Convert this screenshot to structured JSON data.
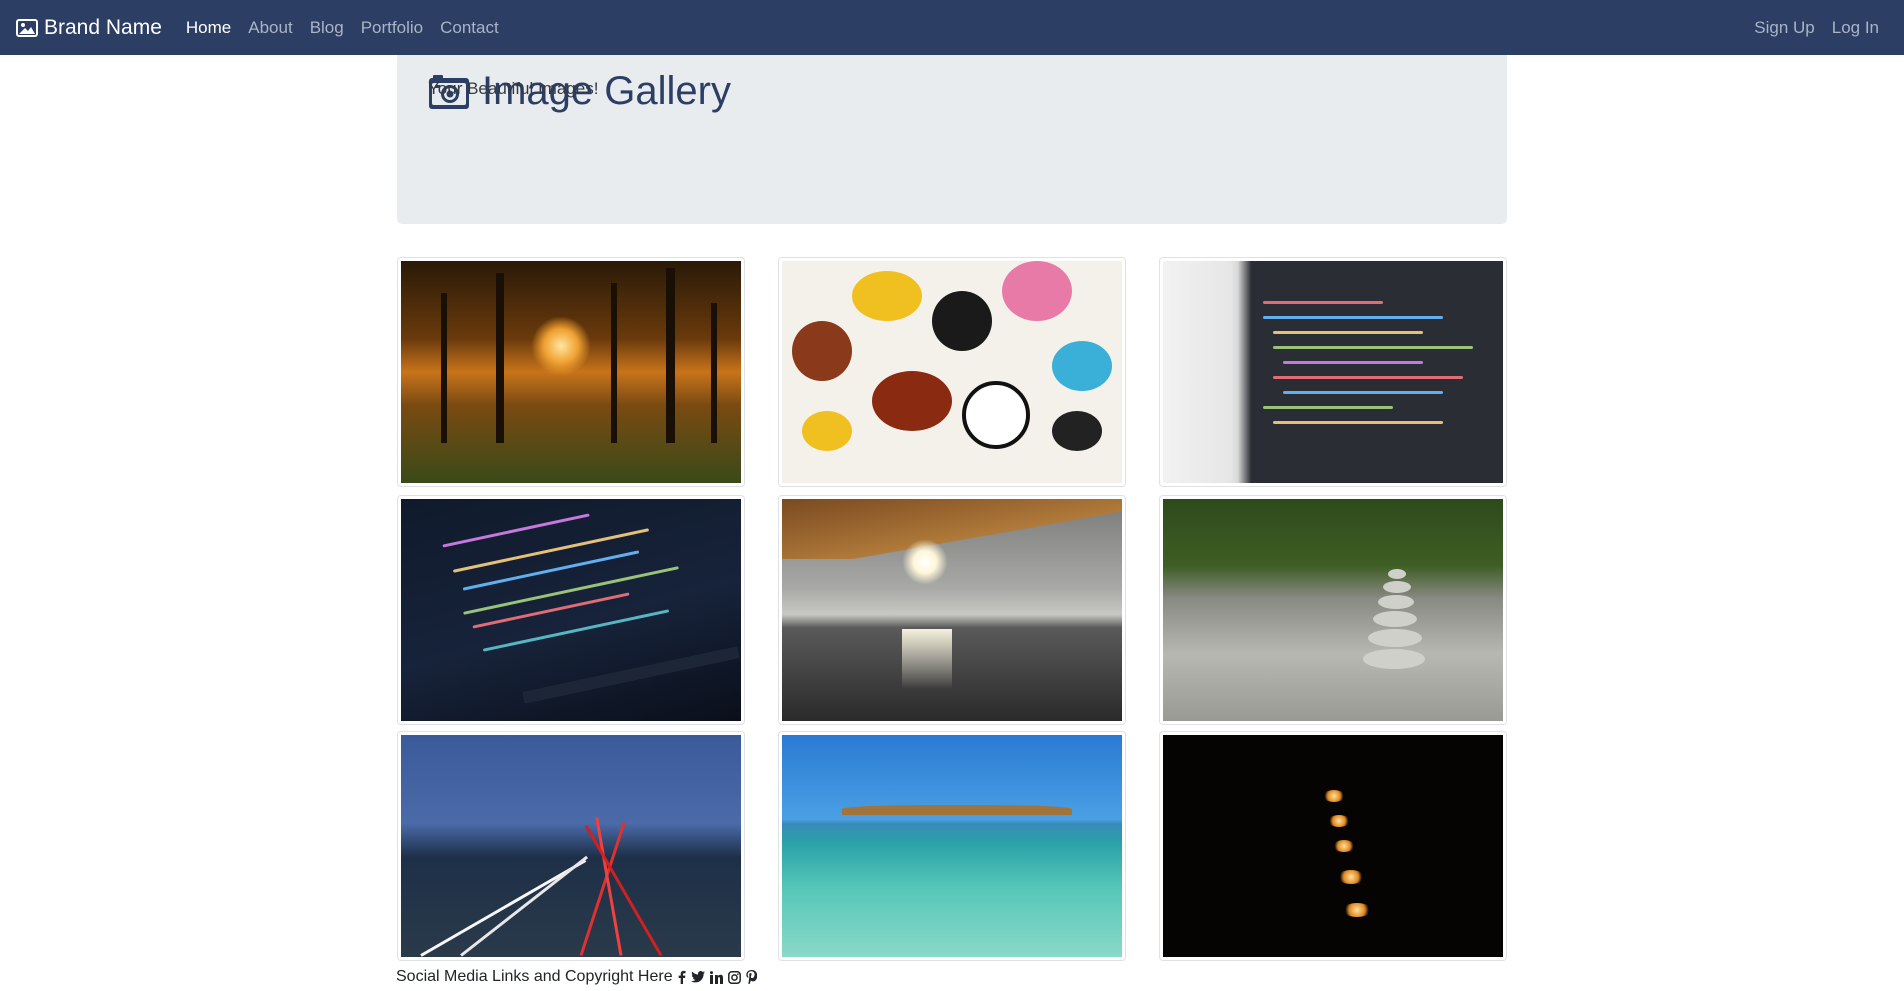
{
  "navbar": {
    "brand": "Brand Name",
    "brand_icon": "image-icon",
    "links": [
      "Home",
      "About",
      "Blog",
      "Portfolio",
      "Contact"
    ],
    "active": "Home",
    "right_links": [
      "Sign Up",
      "Log In"
    ]
  },
  "jumbotron": {
    "icon": "camera-icon",
    "title": "Image Gallery",
    "subtitle": "Your Beautiful Images!"
  },
  "gallery": {
    "images": [
      {
        "subject": "autumn-forest-sunlight"
      },
      {
        "subject": "graffiti-mural"
      },
      {
        "subject": "code-on-laptop-screen"
      },
      {
        "subject": "code-on-dark-laptop"
      },
      {
        "subject": "sunset-sea-terrace"
      },
      {
        "subject": "stone-cairn"
      },
      {
        "subject": "highway-light-trails"
      },
      {
        "subject": "turquoise-sea-island"
      },
      {
        "subject": "candles-in-dark"
      }
    ]
  },
  "footer": {
    "text": "Social Media Links and Copyright Here",
    "social_icons": [
      "facebook-icon",
      "twitter-icon",
      "linkedin-icon",
      "instagram-icon",
      "pinterest-icon"
    ]
  },
  "colors": {
    "navbar_bg": "#2c3e63",
    "jumbotron_bg": "#e9ecef",
    "title": "#2c3e63"
  }
}
